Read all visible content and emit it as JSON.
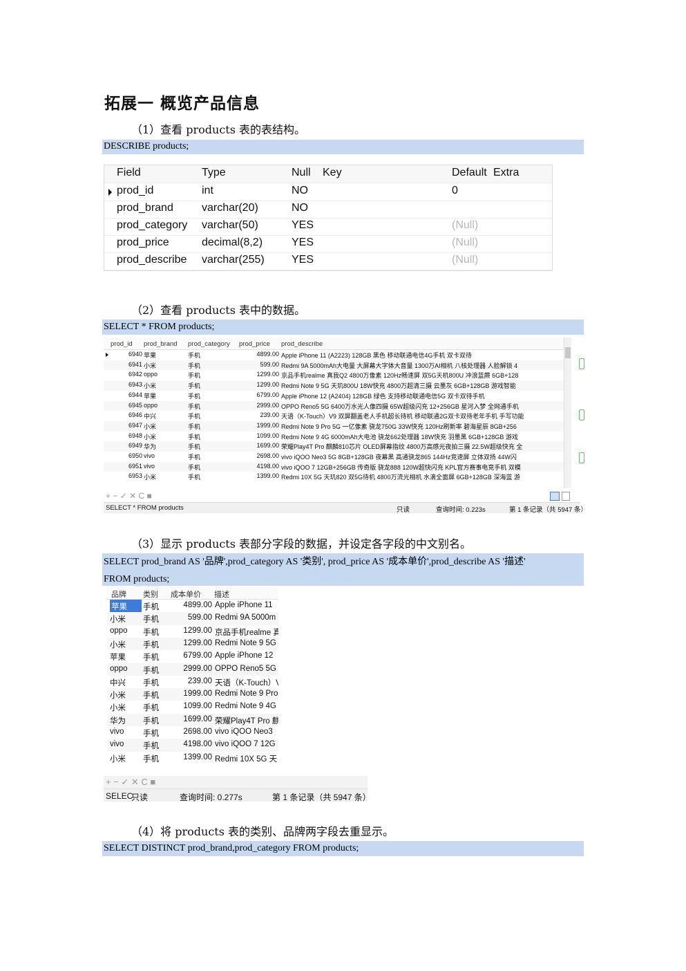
{
  "title": "拓展一  概览产品信息",
  "steps": [
    {
      "label": "（1）查看 products 表的表结构。",
      "sql": "DESCRIBE products;"
    },
    {
      "label": "（2）查看 products 表中的数据。",
      "sql": "SELECT * FROM products;"
    },
    {
      "label": "（3）显示 products 表部分字段的数据，并设定各字段的中文别名。",
      "sql_line1": "SELECT prod_brand AS '品牌',prod_category AS '类别', prod_price AS '成本单价',prod_describe AS '描述'",
      "sql_line2": "FROM products;"
    },
    {
      "label": "（4）将 products 表的类别、品牌两字段去重显示。",
      "sql": "SELECT DISTINCT prod_brand,prod_category FROM products;"
    }
  ],
  "struct_table": {
    "headers": [
      "Field",
      "Type",
      "Null",
      "Key",
      "Default",
      "Extra"
    ],
    "rows": [
      {
        "field": "prod_id",
        "type": "int",
        "null": "NO",
        "key": "",
        "default": "0",
        "extra": ""
      },
      {
        "field": "prod_brand",
        "type": "varchar(20)",
        "null": "NO",
        "key": "",
        "default": "",
        "extra": ""
      },
      {
        "field": "prod_category",
        "type": "varchar(50)",
        "null": "YES",
        "key": "",
        "default": "(Null)",
        "extra": ""
      },
      {
        "field": "prod_price",
        "type": "decimal(8,2)",
        "null": "YES",
        "key": "",
        "default": "(Null)",
        "extra": ""
      },
      {
        "field": "prod_describe",
        "type": "varchar(255)",
        "null": "YES",
        "key": "",
        "default": "(Null)",
        "extra": ""
      }
    ]
  },
  "grid1": {
    "headers": [
      "prod_id",
      "prod_brand",
      "prod_category",
      "prod_price",
      "prod_describe"
    ],
    "rows": [
      [
        "6940",
        "苹果",
        "手机",
        "4899.00",
        "Apple iPhone 11 (A2223) 128GB 黑色 移动联通电信4G手机 双卡双待"
      ],
      [
        "6941",
        "小米",
        "手机",
        "599.00",
        "Redmi 9A 5000mAh大电量 大屏幕大字体大音量 1300万AI相机 八核处理器 人脸解锁 4"
      ],
      [
        "6942",
        "oppo",
        "手机",
        "1299.00",
        "京品手机realme 真我Q2 4800万像素 120Hz畅速屏 双5G天机800U 冲浪蓝蕨 6GB+128"
      ],
      [
        "6943",
        "小米",
        "手机",
        "1299.00",
        "Redmi Note 9 5G 天玑800U  18W快充 4800万超清三摄 云墨灰 6GB+128GB 游戏智能"
      ],
      [
        "6944",
        "苹果",
        "手机",
        "6799.00",
        "Apple iPhone 12 (A2404) 128GB 绿色 支持移动联通电信5G 双卡双待手机"
      ],
      [
        "6945",
        "oppo",
        "手机",
        "2999.00",
        "OPPO Reno5 5G 6400万水光人像四摄 65W超级闪充  12+256GB 星河入梦 全网通手机"
      ],
      [
        "6946",
        "中兴",
        "手机",
        "239.00",
        "天语（K-Touch）V9 双屏翻盖老人手机超长待机 移动联通2G双卡双待老年手机 手写功能"
      ],
      [
        "6947",
        "小米",
        "手机",
        "1999.00",
        "Redmi Note 9 Pro 5G 一亿像素 骁龙750G 33W快充 120Hz刷新率 碧海星辰 8GB+256"
      ],
      [
        "6948",
        "小米",
        "手机",
        "1099.00",
        "Redmi Note 9 4G 6000mAh大电池 骁龙662处理器  18W快充 羽墨黑 6GB+128GB 游戏"
      ],
      [
        "6949",
        "华为",
        "手机",
        "1699.00",
        "荣耀Play4T Pro 麒麟810芯片 OLED屏幕指纹 4800万高感光夜拍三摄 22.5W超级快充 全"
      ],
      [
        "6950",
        "vivo",
        "手机",
        "2698.00",
        "vivo iQOO Neo3 5G 8GB+128GB 夜幕黑 高通骁龙865 144Hz竞速屏 立体双扬 44W闪"
      ],
      [
        "6951",
        "vivo",
        "手机",
        "4198.00",
        "vivo iQOO 7 12GB+256GB 传奇版 骁龙888 120W超快闪充 KPL官方赛事电竞手机 双模"
      ],
      [
        "6953",
        "小米",
        "手机",
        "1399.00",
        "Redmi 10X 5G 天玑820 双5G待机 4800万流光相机 水滴全面屏 6GB+128GB 深海蓝 游"
      ]
    ],
    "toolbar": "+ − ✓ ✕ C ■",
    "status_sql": "SELECT * FROM products",
    "status_mode": "只读",
    "status_time": "查询时间: 0.223s",
    "status_records": "第 1 条记录（共 5947 条）"
  },
  "grid2": {
    "headers": [
      "品牌",
      "类别",
      "成本单价",
      "描述"
    ],
    "rows": [
      [
        "苹果",
        "手机",
        "4899.00",
        "Apple iPhone 11"
      ],
      [
        "小米",
        "手机",
        "599.00",
        "Redmi 9A 5000m"
      ],
      [
        "oppo",
        "手机",
        "1299.00",
        "京品手机realme 真"
      ],
      [
        "小米",
        "手机",
        "1299.00",
        "Redmi Note 9 5G"
      ],
      [
        "苹果",
        "手机",
        "6799.00",
        "Apple iPhone 12"
      ],
      [
        "oppo",
        "手机",
        "2999.00",
        "OPPO Reno5 5G"
      ],
      [
        "中兴",
        "手机",
        "239.00",
        "天语（K-Touch）V"
      ],
      [
        "小米",
        "手机",
        "1999.00",
        "Redmi Note 9 Pro"
      ],
      [
        "小米",
        "手机",
        "1099.00",
        "Redmi Note 9 4G"
      ],
      [
        "华为",
        "手机",
        "1699.00",
        "荣耀Play4T Pro 麒"
      ],
      [
        "vivo",
        "手机",
        "2698.00",
        "vivo iQOO Neo3"
      ],
      [
        "vivo",
        "手机",
        "4198.00",
        "vivo iQOO 7 12G"
      ],
      [
        "小米",
        "手机",
        "1399.00",
        "Redmi 10X 5G 天"
      ]
    ],
    "toolbar": "+ − ✓ ✕ C ■",
    "status_sql": "SELEC",
    "status_mode": "只读",
    "status_time": "查询时间: 0.277s",
    "status_records": "第 1 条记录（共 5947 条）"
  }
}
